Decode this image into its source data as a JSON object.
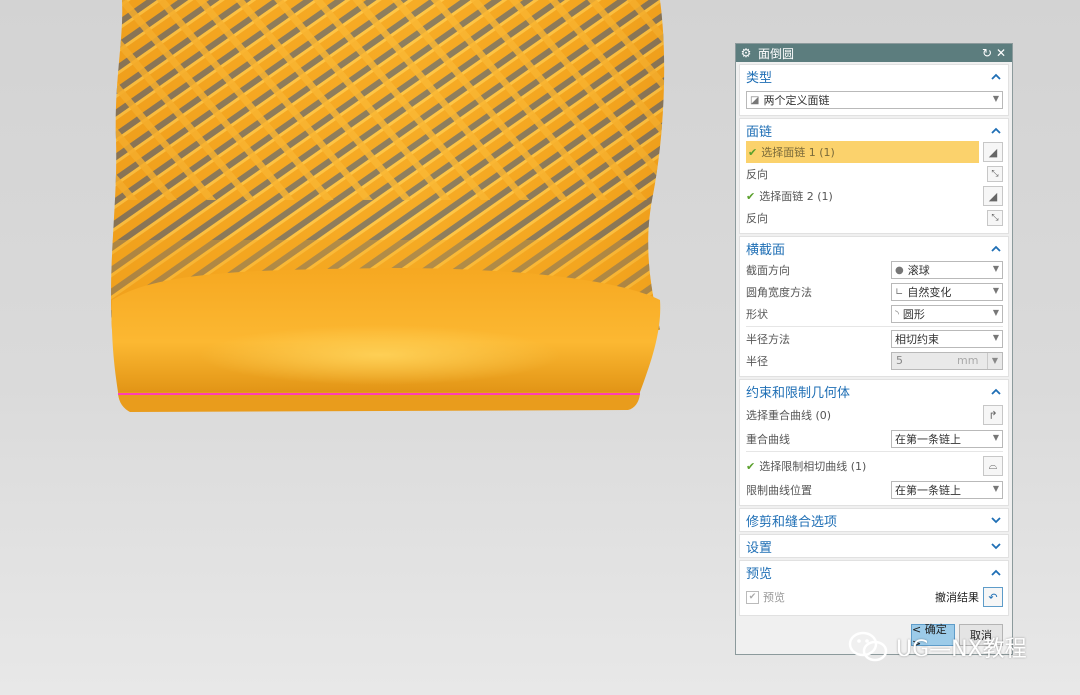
{
  "dialog": {
    "title": "面倒圆",
    "sections": {
      "type": {
        "title": "类型",
        "combo": "两个定义面链"
      },
      "face_chain": {
        "title": "面链",
        "select1": "选择面链 1 (1)",
        "reverse1": "反向",
        "select2": "选择面链 2 (1)",
        "reverse2": "反向"
      },
      "cross_section": {
        "title": "横截面",
        "orientation_label": "截面方向",
        "orientation_value": "滚球",
        "width_label": "圆角宽度方法",
        "width_value": "自然变化",
        "shape_label": "形状",
        "shape_value": "圆形",
        "radius_method_label": "半径方法",
        "radius_method_value": "相切约束",
        "radius_label": "半径",
        "radius_value": "5",
        "radius_unit": "mm"
      },
      "constraints": {
        "title": "约束和限制几何体",
        "select_curve": "选择重合曲线 (0)",
        "coincident_label": "重合曲线",
        "coincident_value": "在第一条链上",
        "select_limit": "选择限制相切曲线 (1)",
        "limit_pos_label": "限制曲线位置",
        "limit_pos_value": "在第一条链上"
      },
      "trim": {
        "title": "修剪和缝合选项"
      },
      "settings": {
        "title": "设置"
      },
      "preview": {
        "title": "预览",
        "preview_label": "预览",
        "undo_label": "撤消结果"
      }
    },
    "ok_label": "< 确定 >",
    "cancel_label": "取消"
  },
  "watermark": "UG—NX教程",
  "colors": {
    "title_bar": "#5c7d7e",
    "section_title": "#1f6fb5",
    "highlight": "#fbd26c",
    "model": "#f5a623",
    "edge_line": "#ff3fb4"
  }
}
